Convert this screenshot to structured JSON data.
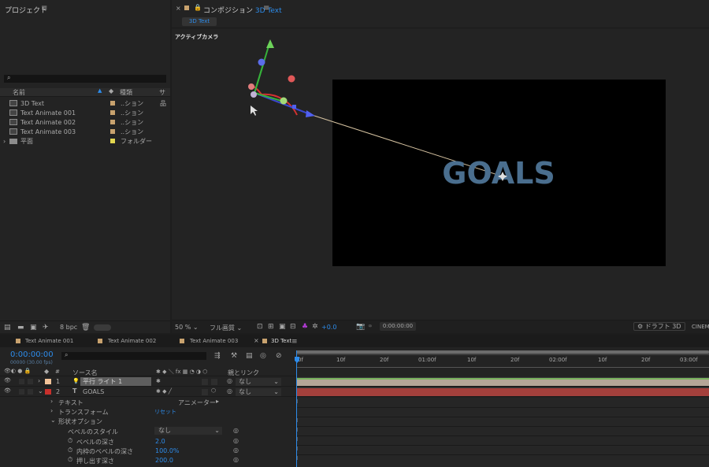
{
  "project": {
    "title": "プロジェクト",
    "menu": "≡",
    "search_placeholder": "",
    "columns": {
      "name": "名前",
      "type": "種類",
      "size": "サ"
    },
    "items": [
      {
        "name": "3D Text",
        "type": "..ション",
        "color": "#c8a26e"
      },
      {
        "name": "Text Animate 001",
        "type": "..ション",
        "color": "#c8a26e"
      },
      {
        "name": "Text Animate 002",
        "type": "..ション",
        "color": "#c8a26e"
      },
      {
        "name": "Text Animate 003",
        "type": "..ション",
        "color": "#c8a26e"
      },
      {
        "name": "平面",
        "type": "フォルダー",
        "color": "#e2d64f"
      }
    ],
    "bpc": "8 bpc"
  },
  "comp": {
    "close": "×",
    "title": "コンポジション",
    "name": "3D Text",
    "menu": "≡",
    "tab": "3D Text",
    "camera": "アクティブカメラ",
    "text": "GOALS",
    "zoom": "50 %",
    "resolution": "フル画質",
    "exposure": "+0.0",
    "timecode": "0:00:00:00",
    "draft": "ドラフト 3D",
    "renderer": "CINEMA"
  },
  "timeline": {
    "tabs": [
      "Text Animate 001",
      "Text Animate 002",
      "Text Animate 003",
      "3D Text"
    ],
    "timecode": "0:00:00:00",
    "frames": "00000 (30.00 fps)",
    "headers": {
      "source": "ソース名",
      "parent": "親とリンク",
      "num": "#"
    },
    "ruler": [
      "0f",
      "10f",
      "20f",
      "01:00f",
      "10f",
      "20f",
      "02:00f",
      "10f",
      "20f",
      "03:00f"
    ],
    "layers": [
      {
        "num": "1",
        "name": "平行 ライト 1",
        "parent": "なし",
        "color": "#f3c49a"
      },
      {
        "num": "2",
        "name": "GOALS",
        "parent": "なし",
        "color": "#c8302c"
      }
    ],
    "props": {
      "text": "テキスト",
      "animator": "アニメーター",
      "transform": "トランスフォーム",
      "reset": "リセット",
      "geometry": "形状オプション",
      "bevel_style": "ベベルのスタイル",
      "bevel_style_val": "なし",
      "bevel_depth": "ベベルの深さ",
      "bevel_depth_val": "2.0",
      "inner_bevel": "内枠のベベルの深さ",
      "inner_bevel_val": "100.0%",
      "extrude": "押し出す深さ",
      "extrude_val": "200.0"
    }
  },
  "colors": {
    "accent": "#2d8ceb",
    "goals": "#4a6e8e",
    "light_bar": "#7ab35f",
    "text_bar": "#a4403c"
  }
}
